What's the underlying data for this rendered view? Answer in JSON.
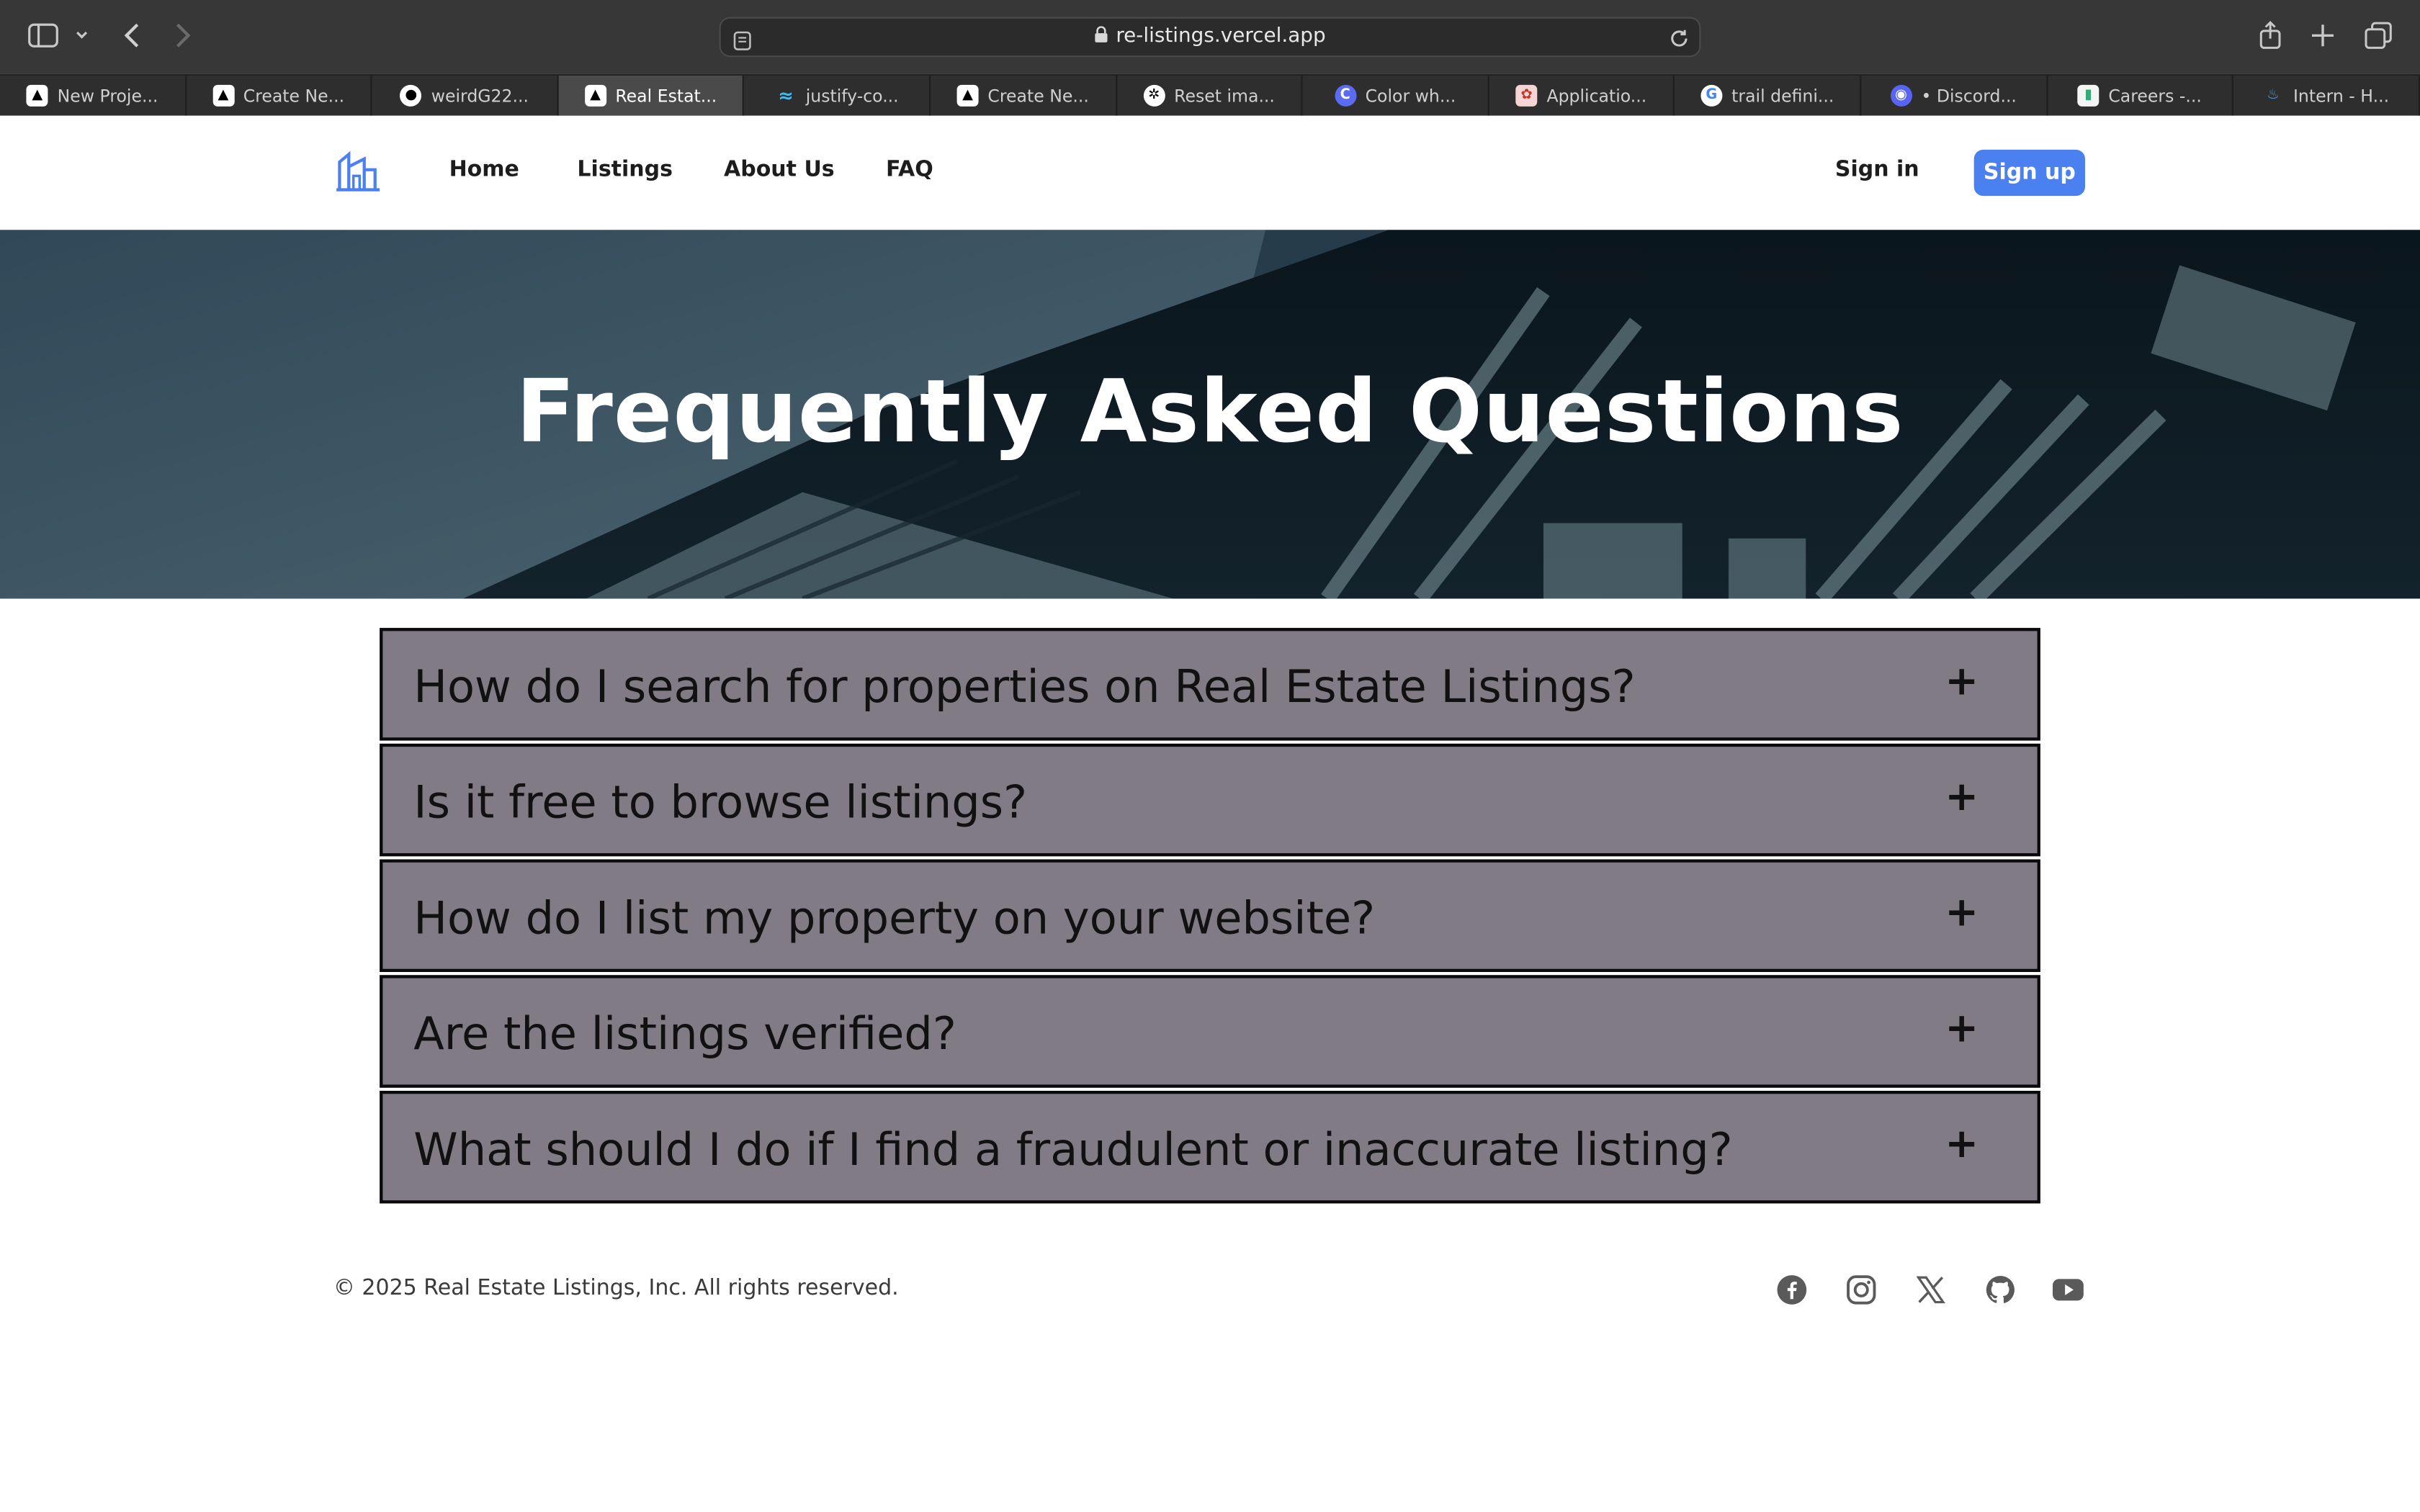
{
  "browser": {
    "url": "re-listings.vercel.app",
    "tabs": [
      {
        "label": "New Proje...",
        "icon": "vercel-icon",
        "active": false
      },
      {
        "label": "Create Ne...",
        "icon": "vercel-icon",
        "active": false
      },
      {
        "label": "weirdG22...",
        "icon": "github-icon",
        "active": false
      },
      {
        "label": "Real Estat...",
        "icon": "vercel-icon",
        "active": true
      },
      {
        "label": "justify-co...",
        "icon": "tailwind-icon",
        "active": false
      },
      {
        "label": "Create Ne...",
        "icon": "vercel-icon",
        "active": false
      },
      {
        "label": "Reset ima...",
        "icon": "chatgpt-icon",
        "active": false
      },
      {
        "label": "Color wh...",
        "icon": "canva-icon",
        "active": false
      },
      {
        "label": "Applicatio...",
        "icon": "app-icon",
        "active": false
      },
      {
        "label": "trail defini...",
        "icon": "google-icon",
        "active": false
      },
      {
        "label": "• Discord...",
        "icon": "discord-icon",
        "active": false
      },
      {
        "label": "Careers -...",
        "icon": "careers-icon",
        "active": false
      },
      {
        "label": "Intern - H...",
        "icon": "intern-icon",
        "active": false
      }
    ]
  },
  "nav": {
    "links": [
      "Home",
      "Listings",
      "About Us",
      "FAQ"
    ],
    "signin": "Sign in",
    "signup": "Sign up"
  },
  "hero": {
    "title": "Frequently Asked Questions"
  },
  "faq": {
    "items": [
      {
        "question": "How do I search for properties on Real Estate Listings?",
        "toggle": "+"
      },
      {
        "question": "Is it free to browse listings?",
        "toggle": "+"
      },
      {
        "question": "How do I list my property on your website?",
        "toggle": "+"
      },
      {
        "question": "Are the listings verified?",
        "toggle": "+"
      },
      {
        "question": "What should I do if I find a fraudulent or inaccurate listing?",
        "toggle": "+"
      }
    ]
  },
  "footer": {
    "copyright": "© 2025 Real Estate Listings, Inc. All rights reserved.",
    "social": [
      "facebook-icon",
      "instagram-icon",
      "x-icon",
      "github-icon",
      "youtube-icon"
    ]
  },
  "colors": {
    "accent": "#4a80f0",
    "faq_bg": "#817b86",
    "toolbar_bg": "#373737"
  }
}
